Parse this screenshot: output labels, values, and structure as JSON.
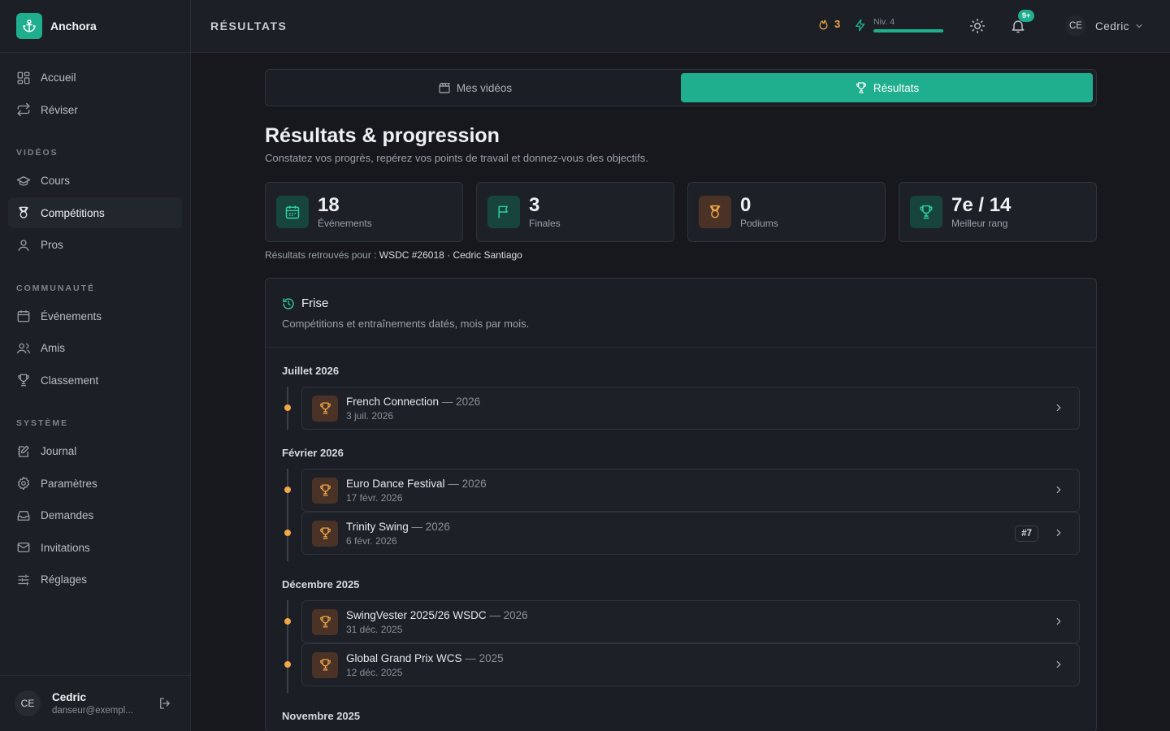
{
  "app": {
    "name": "Anchora"
  },
  "sidebar": {
    "items_top": [
      {
        "label": "Accueil",
        "icon": "dashboard-icon"
      },
      {
        "label": "Réviser",
        "icon": "repeat-icon"
      }
    ],
    "section_videos": "VIDÉOS",
    "items_videos": [
      {
        "label": "Cours",
        "icon": "graduation-cap-icon"
      },
      {
        "label": "Compétitions",
        "icon": "medal-icon",
        "active": true
      },
      {
        "label": "Pros",
        "icon": "user-icon"
      }
    ],
    "section_community": "COMMUNAUTÉ",
    "items_community": [
      {
        "label": "Événements",
        "icon": "calendar-icon"
      },
      {
        "label": "Amis",
        "icon": "users-icon"
      },
      {
        "label": "Classement",
        "icon": "trophy-icon"
      }
    ],
    "section_system": "SYSTÈME",
    "items_system": [
      {
        "label": "Journal",
        "icon": "journal-icon"
      },
      {
        "label": "Paramètres",
        "icon": "gear-icon"
      },
      {
        "label": "Demandes",
        "icon": "inbox-icon"
      },
      {
        "label": "Invitations",
        "icon": "mail-icon"
      },
      {
        "label": "Réglages",
        "icon": "sliders-icon"
      }
    ],
    "footer": {
      "initials": "CE",
      "name": "Cedric",
      "email": "danseur@exempl..."
    }
  },
  "topbar": {
    "page_label": "RÉSULTATS",
    "streak": "3",
    "level": "Niv. 4",
    "level_progress": 1.0,
    "notif_badge": "9+",
    "user_initials": "CE",
    "user_name": "Cedric"
  },
  "tabs": [
    {
      "label": "Mes vidéos",
      "active": false
    },
    {
      "label": "Résultats",
      "active": true
    }
  ],
  "page": {
    "title": "Résultats & progression",
    "subtitle": "Constatez vos progrès, repérez vos points de travail et donnez-vous des objectifs."
  },
  "stats": [
    {
      "value": "18",
      "label": "Événements",
      "icon": "calendar-icon",
      "tone": "teal"
    },
    {
      "value": "3",
      "label": "Finales",
      "icon": "flag-icon",
      "tone": "teal"
    },
    {
      "value": "0",
      "label": "Podiums",
      "icon": "medal-icon",
      "tone": "orange"
    },
    {
      "value": "7e / 14",
      "label": "Meilleur rang",
      "icon": "trophy-icon",
      "tone": "teal"
    }
  ],
  "found": {
    "prefix": "Résultats retrouvés pour :",
    "value": "WSDC #26018 · Cedric Santiago"
  },
  "timeline": {
    "title": "Frise",
    "subtitle": "Compétitions et entraînements datés, mois par mois.",
    "months": [
      {
        "label": "Juillet 2026",
        "events": [
          {
            "name": "French Connection",
            "year": "— 2026",
            "date": "3 juil. 2026",
            "rank": ""
          }
        ]
      },
      {
        "label": "Février 2026",
        "events": [
          {
            "name": "Euro Dance Festival",
            "year": "— 2026",
            "date": "17 févr. 2026",
            "rank": ""
          },
          {
            "name": "Trinity Swing",
            "year": "— 2026",
            "date": "6 févr. 2026",
            "rank": "#7"
          }
        ]
      },
      {
        "label": "Décembre 2025",
        "events": [
          {
            "name": "SwingVester 2025/26 WSDC",
            "year": "— 2026",
            "date": "31 déc. 2025",
            "rank": ""
          },
          {
            "name": "Global Grand Prix WCS",
            "year": "— 2025",
            "date": "12 déc. 2025",
            "rank": ""
          }
        ]
      },
      {
        "label": "Novembre 2025",
        "events": []
      }
    ]
  },
  "colors": {
    "accent": "#1fae8e",
    "warn": "#f0a848",
    "bg": "#16181d"
  }
}
